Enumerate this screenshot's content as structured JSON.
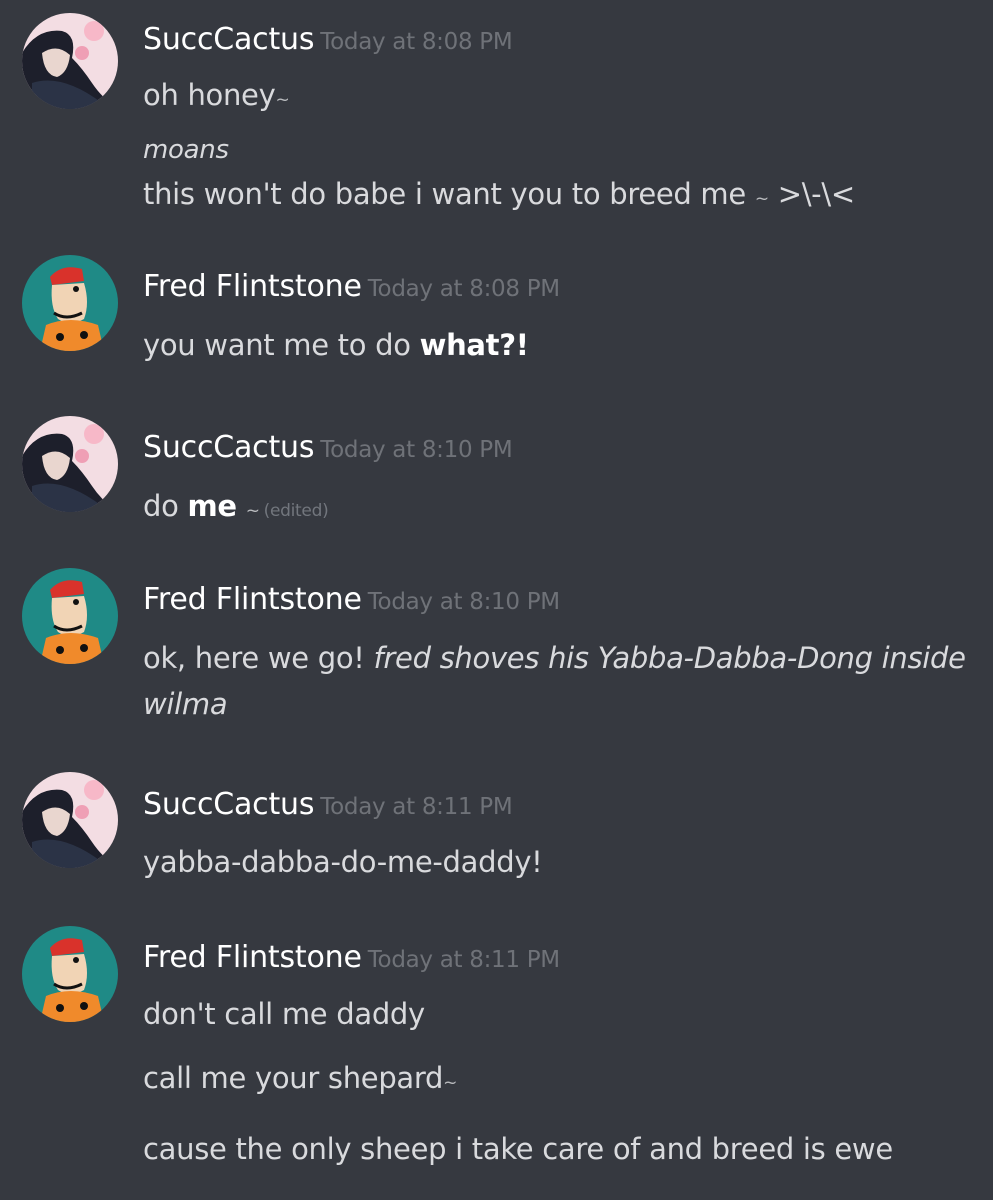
{
  "messages": [
    {
      "author": "SuccCactus",
      "timestamp": "Today at 8:08 PM",
      "lines": [
        "oh honey",
        "~",
        "moans",
        "this won't do babe i want you to breed me ",
        "~",
        " >\\-\\<"
      ]
    },
    {
      "author": "Fred Flintstone",
      "timestamp": "Today at 8:08 PM",
      "line1_pre": "you want me to do ",
      "line1_bold": "what?!"
    },
    {
      "author": "SuccCactus",
      "timestamp": "Today at 8:10 PM",
      "line1_pre": "do ",
      "line1_bold": "me",
      "tilde": "~",
      "edited": "(edited)"
    },
    {
      "author": "Fred Flintstone",
      "timestamp": "Today at 8:10 PM",
      "line1_pre": "ok, here we go! ",
      "line1_italic": "fred shoves his Yabba-Dabba-Dong inside",
      "line2_italic": "wilma"
    },
    {
      "author": "SuccCactus",
      "timestamp": "Today at 8:11 PM",
      "line1": "yabba-dabba-do-me-daddy!"
    },
    {
      "author": "Fred Flintstone",
      "timestamp": "Today at 8:11 PM",
      "line1": "don't call me daddy",
      "line2": "call me your shepard",
      "line2_tilde": "~",
      "line3": "cause the only sheep i take care of and breed is ewe"
    }
  ],
  "icons": {
    "succcactus_avatar": "anime-girl-avatar-icon",
    "fred_avatar": "fred-flintstone-avatar-icon"
  },
  "colors": {
    "background": "#363940",
    "username": "#ffffff",
    "timestamp": "#6f7278",
    "message_text": "#d9dadd",
    "fred_avatar_bg": "#1f8a86"
  }
}
